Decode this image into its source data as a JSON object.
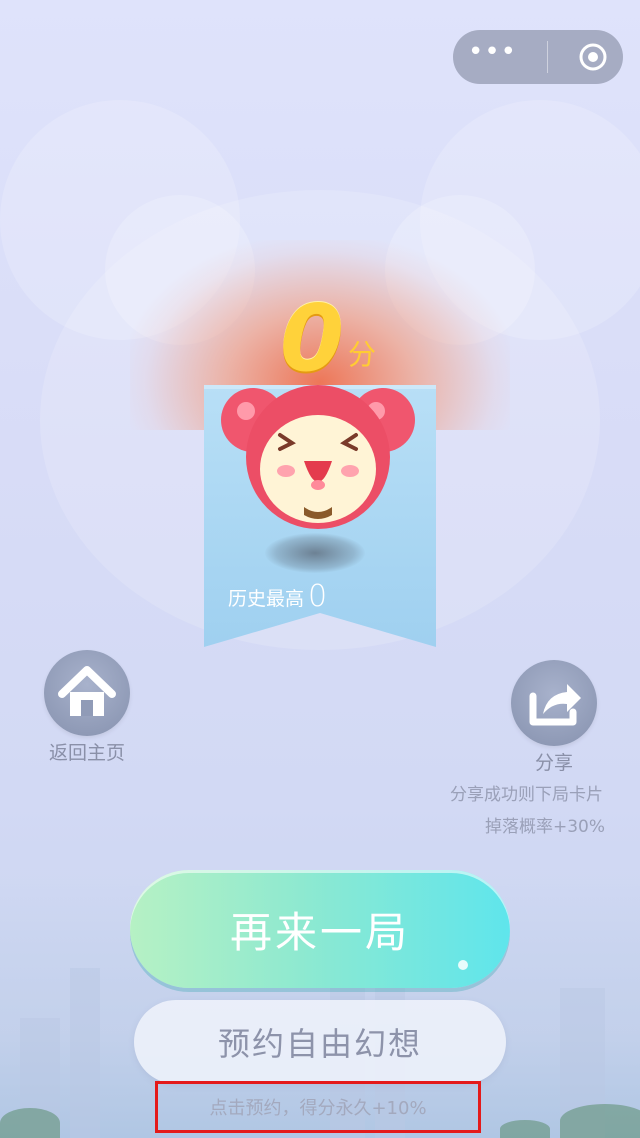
{
  "top_bar": {
    "menu_icon": "more-dots-icon",
    "close_icon": "target-circle-icon"
  },
  "result": {
    "score_value": "0",
    "score_unit": "分",
    "history_label": "历史最高",
    "history_value": "0"
  },
  "actions": {
    "home_label": "返回主页",
    "share_label": "分享",
    "share_tip_line1": "分享成功则下局卡片",
    "share_tip_line2": "掉落概率+30%",
    "replay_label": "再来一局",
    "reserve_label": "预约自由幻想",
    "reserve_tip": "点击预约，得分永久+10%"
  },
  "colors": {
    "score_gold": "#ffd23a",
    "replay_gradient_start": "#b6f1c4",
    "replay_gradient_end": "#5fe5ec",
    "highlight_border": "#e41a1a",
    "ribbon_blue": "#a6d4f2"
  }
}
